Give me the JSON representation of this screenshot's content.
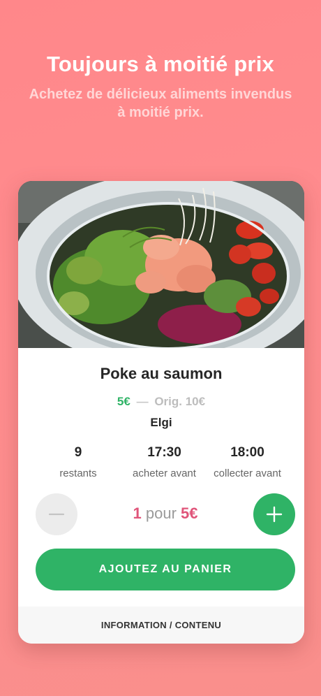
{
  "header": {
    "title": "Toujours à moitié prix",
    "subtitle": "Achetez de délicieux aliments invendus à moitié prix."
  },
  "product": {
    "image_icon": "poke-bowl-photo",
    "name": "Poke au saumon",
    "price_now": "5€",
    "price_separator": "—",
    "price_original": "Orig. 10€",
    "store": "Elgi"
  },
  "stats": [
    {
      "value": "9",
      "label": "restants"
    },
    {
      "value": "17:30",
      "label": "acheter avant"
    },
    {
      "value": "18:00",
      "label": "collecter avant"
    }
  ],
  "quantity": {
    "count": "1",
    "word": "pour",
    "total": "5€",
    "minus_icon": "minus-icon",
    "plus_icon": "plus-icon"
  },
  "cart": {
    "add_label": "AJOUTEZ AU PANIER"
  },
  "footer": {
    "info_label": "INFORMATION / CONTENU"
  },
  "colors": {
    "background": "#ff8a8c",
    "accent_green": "#2fb366",
    "accent_pink": "#e0557a"
  }
}
